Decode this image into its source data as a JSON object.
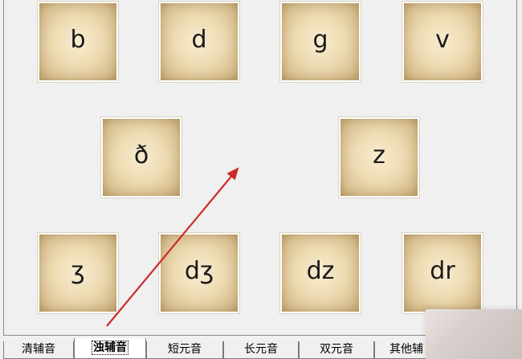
{
  "cards": [
    {
      "label": "b"
    },
    {
      "label": "d"
    },
    {
      "label": "g"
    },
    {
      "label": "v"
    },
    {
      "label": "ð"
    },
    {
      "label": "z"
    },
    {
      "label": "ʒ"
    },
    {
      "label": "dʒ"
    },
    {
      "label": "dz"
    },
    {
      "label": "dr"
    }
  ],
  "tabs": [
    {
      "label": "清辅音"
    },
    {
      "label": "浊辅音"
    },
    {
      "label": "短元音"
    },
    {
      "label": "长元音"
    },
    {
      "label": "双元音"
    },
    {
      "label": "其他辅"
    }
  ],
  "active_tab": "浊辅音",
  "colors": {
    "window_bg": "#f0f0f0",
    "card_paper": "#e2cda0",
    "arrow": "#cc2a2a"
  }
}
